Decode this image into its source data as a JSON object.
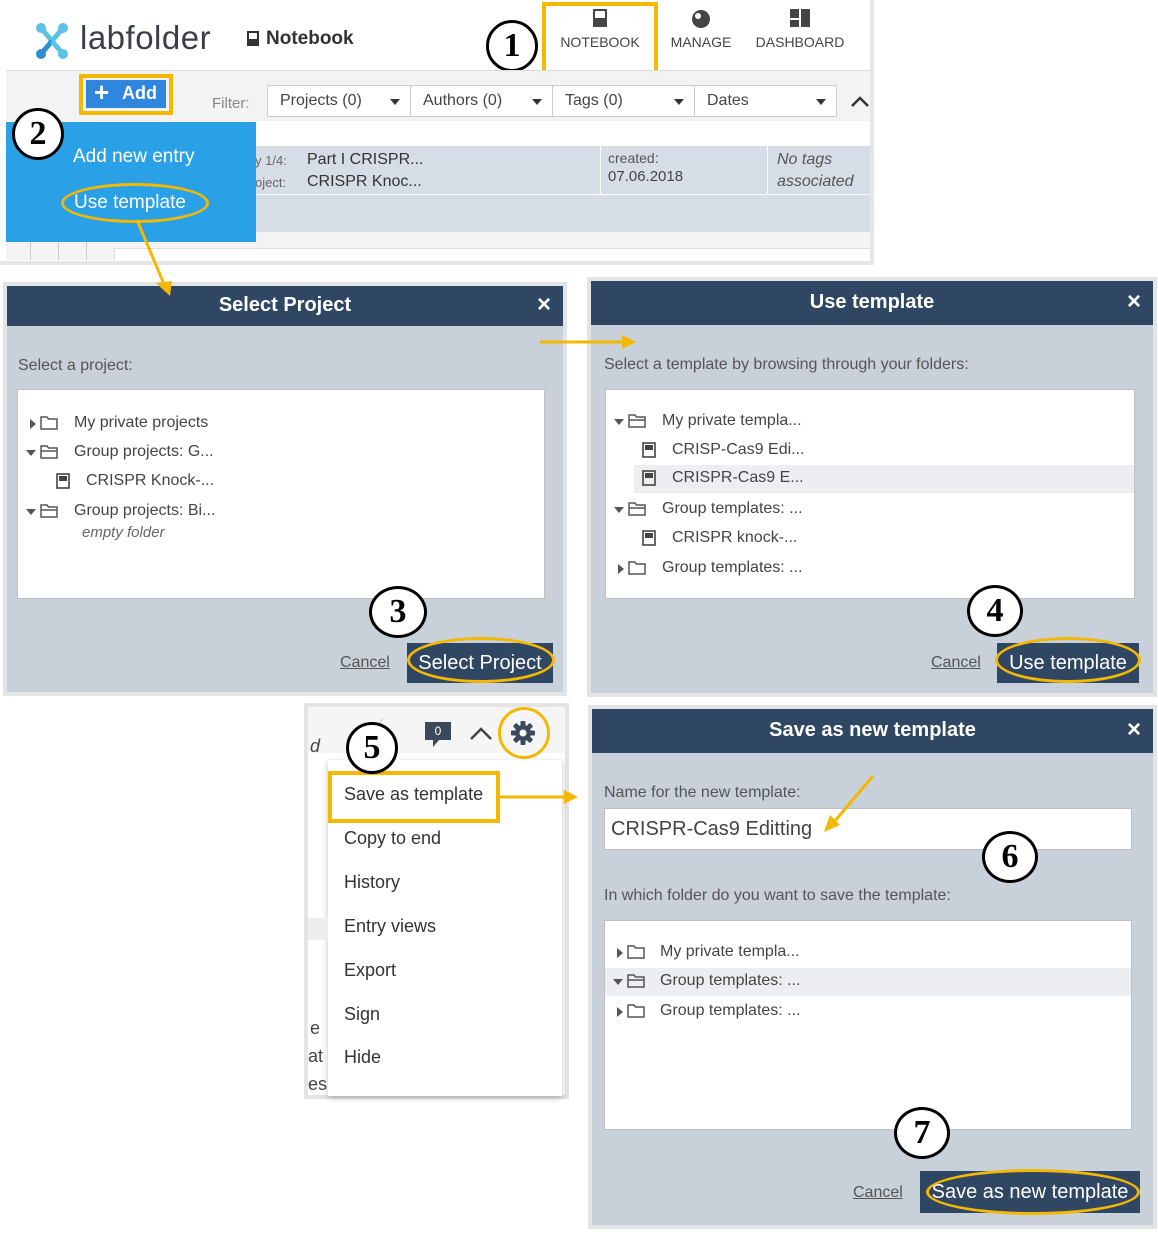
{
  "app": {
    "logo_text": "labfolder",
    "notebook_label": "Notebook",
    "nav": [
      {
        "label": "NOTEBOOK",
        "icon": "notebook-icon"
      },
      {
        "label": "MANAGE",
        "icon": "manage-icon"
      },
      {
        "label": "DASHBOARD",
        "icon": "dashboard-icon"
      }
    ],
    "add_label": "Add",
    "filter_label": "Filter:",
    "filters": [
      "Projects (0)",
      "Authors (0)",
      "Tags (0)",
      "Dates"
    ],
    "dropdown": {
      "add_new_entry": "Add new entry",
      "use_template": "Use template"
    },
    "entry": {
      "entry_key": "y 1/4:",
      "entry_value": "Part I CRISPR...",
      "project_key": "oject:",
      "project_value": "CRISPR Knoc...",
      "created_label": "created:",
      "created_date": "07.06.2018",
      "tags_line1": "No tags",
      "tags_line2": "associated"
    }
  },
  "select_project": {
    "title": "Select Project",
    "close": "×",
    "label": "Select a project:",
    "tree": [
      {
        "text": "My private projects",
        "expand": "collapsed",
        "icon": "folder-icon"
      },
      {
        "text": "Group projects: G...",
        "expand": "expanded",
        "icon": "folder-open-icon"
      },
      {
        "text": "CRISPR Knock-...",
        "expand": "none",
        "icon": "notebook-icon"
      },
      {
        "text": "Group projects: Bi...",
        "expand": "expanded",
        "icon": "folder-open-icon"
      },
      {
        "text": "empty folder",
        "expand": "none",
        "icon": ""
      }
    ],
    "cancel": "Cancel",
    "submit": "Select Project"
  },
  "use_template": {
    "title": "Use template",
    "close": "×",
    "label": "Select a template by browsing through your folders:",
    "tree": [
      {
        "text": "My private templa...",
        "expand": "expanded",
        "icon": "folder-open-icon"
      },
      {
        "text": "CRISP-Cas9 Edi...",
        "expand": "none",
        "icon": "notebook-icon"
      },
      {
        "text": "CRISPR-Cas9 E...",
        "expand": "none",
        "icon": "notebook-icon",
        "selected": true
      },
      {
        "text": "Group templates: ...",
        "expand": "expanded",
        "icon": "folder-open-icon"
      },
      {
        "text": "CRISPR knock-...",
        "expand": "none",
        "icon": "notebook-icon"
      },
      {
        "text": "Group templates: ...",
        "expand": "collapsed",
        "icon": "folder-icon"
      }
    ],
    "cancel": "Cancel",
    "submit": "Use template"
  },
  "entry_menu": {
    "partial_left_text": "d",
    "comment_count": "0",
    "items": [
      "Save as template",
      "Copy to end",
      "History",
      "Entry views",
      "Export",
      "Sign",
      "Hide"
    ],
    "clip_fragments": [
      "e",
      "at",
      "es"
    ]
  },
  "save_template": {
    "title": "Save as new template",
    "close": "×",
    "name_label": "Name for the new template:",
    "name_value": "CRISPR-Cas9 Editting",
    "folder_label": "In which folder do you want to save the template:",
    "tree": [
      {
        "text": "My private templa...",
        "expand": "collapsed",
        "icon": "folder-icon"
      },
      {
        "text": "Group templates: ...",
        "expand": "expanded",
        "icon": "folder-open-icon",
        "selected": true
      },
      {
        "text": "Group templates: ...",
        "expand": "collapsed",
        "icon": "folder-icon"
      }
    ],
    "cancel": "Cancel",
    "submit": "Save as new template"
  },
  "steps": [
    "1",
    "2",
    "3",
    "4",
    "5",
    "6",
    "7"
  ],
  "colors": {
    "highlight": "#f5b800",
    "header": "#2f4763",
    "dialog_bg": "#c8d0da",
    "add_blue": "#2e86de",
    "menu_blue": "#2aa1e6"
  }
}
